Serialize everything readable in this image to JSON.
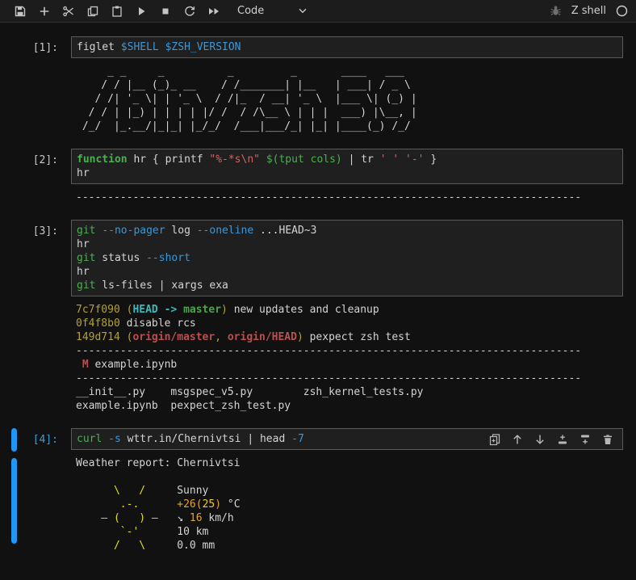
{
  "toolbar": {
    "cell_type": "Code",
    "kernel_name": "Z shell",
    "kernel_status": "idle",
    "icons": [
      "save",
      "add-cell",
      "cut-cells",
      "copy-cells",
      "paste-cells",
      "run-cell",
      "interrupt-kernel",
      "restart-kernel",
      "run-all-cells",
      "debugger-bug",
      "kernel-status-circle"
    ]
  },
  "cell_toolbar_icons": [
    "duplicate-cell",
    "move-cell-up",
    "move-cell-down",
    "insert-cell-above",
    "insert-cell-below",
    "delete-cell"
  ],
  "colors": {
    "accent": "#2196f3",
    "background": "#111111",
    "editor": "#1f1f1f",
    "border": "#5a5a5a"
  },
  "cells": {
    "c1": {
      "prompt": "[1]:",
      "source": [
        [
          {
            "t": "figlet ",
            "c": "d"
          },
          {
            "t": "$SHELL",
            "c": "blu"
          },
          {
            "t": " ",
            "c": "d"
          },
          {
            "t": "$ZSH_VERSION",
            "c": "blu"
          }
        ]
      ],
      "out": [
        [
          {
            "t": "     _ _     _          _         _       ____   ___",
            "c": "d"
          }
        ],
        [
          {
            "t": "    / / |__ (_)_ __    / /_______| |__   | ___| / _ \\",
            "c": "d"
          }
        ],
        [
          {
            "t": "   / /| '_ \\| | '_ \\  / /|_  / __| '_ \\  |___ \\| (_) |",
            "c": "d"
          }
        ],
        [
          {
            "t": "  / / | |_) | | | | |/ /  / /\\__ \\ | | |  ___) |\\__, |",
            "c": "d"
          }
        ],
        [
          {
            "t": " /_/  |_.__/|_|_| |_/_/  /___|___/_| |_| |____(_) /_/",
            "c": "d"
          }
        ]
      ]
    },
    "c2": {
      "prompt": "[2]:",
      "source": [
        [
          {
            "t": "function",
            "c": "grnb"
          },
          {
            "t": " hr { printf ",
            "c": "d"
          },
          {
            "t": "\"%-*s\\n\"",
            "c": "red"
          },
          {
            "t": " ",
            "c": "d"
          },
          {
            "t": "$(tput cols)",
            "c": "grn"
          },
          {
            "t": " | tr ",
            "c": "d"
          },
          {
            "t": "' '",
            "c": "red"
          },
          {
            "t": " ",
            "c": "d"
          },
          {
            "t": "'-'",
            "c": "red"
          },
          {
            "t": " }",
            "c": "d"
          }
        ],
        [
          {
            "t": "hr",
            "c": "d"
          }
        ]
      ],
      "out": [
        [
          {
            "t": "--------------------------------------------------------------------------------",
            "c": "d"
          }
        ]
      ]
    },
    "c3": {
      "prompt": "[3]:",
      "source": [
        [
          {
            "t": "git",
            "c": "grn"
          },
          {
            "t": " ",
            "c": "d"
          },
          {
            "t": "--no-pager",
            "c": "blu"
          },
          {
            "t": " log ",
            "c": "d"
          },
          {
            "t": "--oneline",
            "c": "blu"
          },
          {
            "t": " ...HEAD~3",
            "c": "d"
          }
        ],
        [
          {
            "t": "hr",
            "c": "d"
          }
        ],
        [
          {
            "t": "git",
            "c": "grn"
          },
          {
            "t": " status ",
            "c": "d"
          },
          {
            "t": "--short",
            "c": "blu"
          }
        ],
        [
          {
            "t": "hr",
            "c": "d"
          }
        ],
        [
          {
            "t": "git",
            "c": "grn"
          },
          {
            "t": " ls-files | xargs exa",
            "c": "d"
          }
        ]
      ],
      "out": [
        [
          {
            "t": "7c7f090 (",
            "c": "ayel"
          },
          {
            "t": "HEAD -> ",
            "c": "acyn"
          },
          {
            "t": "master",
            "c": "agrn"
          },
          {
            "t": ")",
            "c": "ayel"
          },
          {
            "t": " new updates and cleanup",
            "c": "d"
          }
        ],
        [
          {
            "t": "0f4f8b0",
            "c": "ayel"
          },
          {
            "t": " disable rcs",
            "c": "d"
          }
        ],
        [
          {
            "t": "149d714 (",
            "c": "ayel"
          },
          {
            "t": "origin/master",
            "c": "ared"
          },
          {
            "t": ", ",
            "c": "ayel"
          },
          {
            "t": "origin/HEAD",
            "c": "ared"
          },
          {
            "t": ")",
            "c": "ayel"
          },
          {
            "t": " pexpect zsh test",
            "c": "d"
          }
        ],
        [
          {
            "t": "--------------------------------------------------------------------------------",
            "c": "d"
          }
        ],
        [
          {
            "t": " ",
            "c": "d"
          },
          {
            "t": "M",
            "c": "ared"
          },
          {
            "t": " example.ipynb",
            "c": "d"
          }
        ],
        [
          {
            "t": "--------------------------------------------------------------------------------",
            "c": "d"
          }
        ],
        [
          {
            "t": "__init__.py    msgspec_v5.py        zsh_kernel_tests.py",
            "c": "d"
          }
        ],
        [
          {
            "t": "example.ipynb  pexpect_zsh_test.py",
            "c": "d"
          }
        ]
      ]
    },
    "c4": {
      "prompt": "[4]:",
      "source": [
        [
          {
            "t": "curl",
            "c": "grn"
          },
          {
            "t": " ",
            "c": "d"
          },
          {
            "t": "-s",
            "c": "blu"
          },
          {
            "t": " wttr.in/Chernivtsi | head ",
            "c": "d"
          },
          {
            "t": "-7",
            "c": "blu"
          }
        ]
      ],
      "out": [
        [
          {
            "t": "Weather report: Chernivtsi",
            "c": "d"
          }
        ],
        [],
        [
          {
            "t": "      \\   /",
            "c": "sun"
          },
          {
            "t": "     Sunny",
            "c": "d"
          }
        ],
        [
          {
            "t": "       .-.",
            "c": "sun"
          },
          {
            "t": "      ",
            "c": "d"
          },
          {
            "t": "+26(",
            "c": "org"
          },
          {
            "t": "25",
            "c": "yl2"
          },
          {
            "t": ")",
            "c": "org"
          },
          {
            "t": " °C",
            "c": "d"
          }
        ],
        [
          {
            "t": "    ― (   ) ―",
            "c": "sun"
          },
          {
            "t": "   ",
            "c": "d"
          },
          {
            "t": "↘ ",
            "c": "d"
          },
          {
            "t": "16",
            "c": "org"
          },
          {
            "t": " km/h",
            "c": "d"
          }
        ],
        [
          {
            "t": "       `-'",
            "c": "sun"
          },
          {
            "t": "      10 km",
            "c": "d"
          }
        ],
        [
          {
            "t": "      /   \\",
            "c": "sun"
          },
          {
            "t": "     0.0 mm",
            "c": "d"
          }
        ]
      ]
    }
  }
}
